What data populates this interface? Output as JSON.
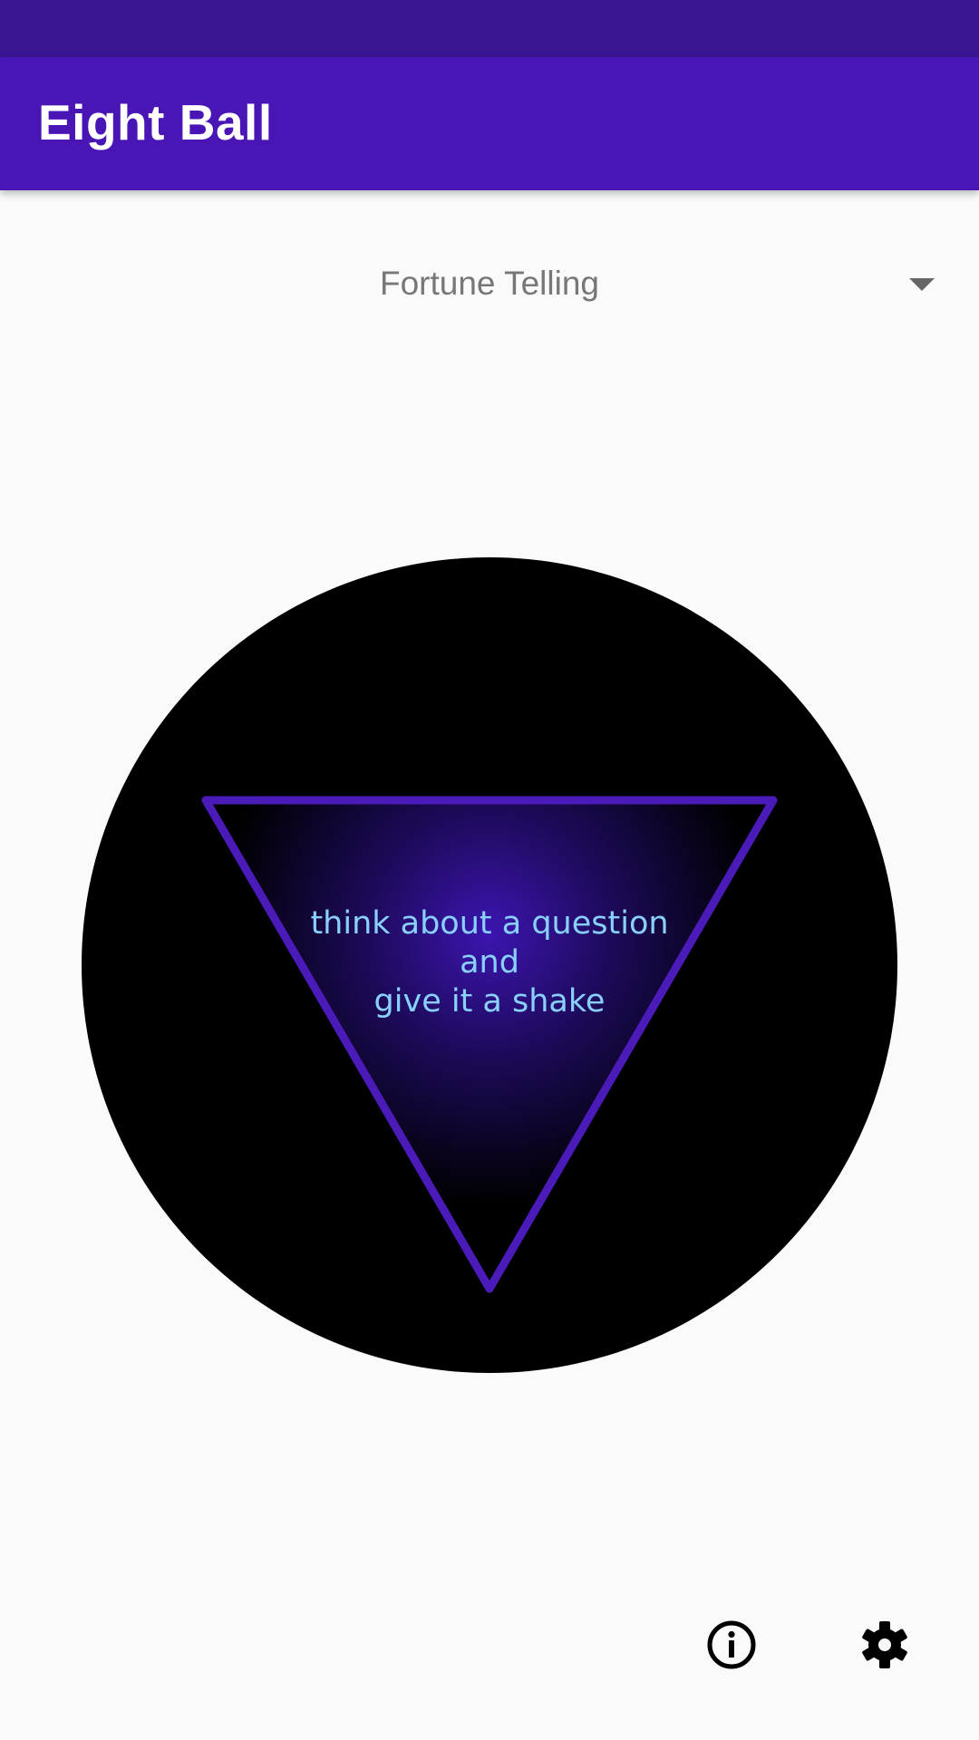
{
  "app_bar": {
    "title": "Eight Ball"
  },
  "mode_spinner": {
    "selected": "Fortune Telling"
  },
  "eight_ball": {
    "answer_lines": [
      "think about a question",
      "and",
      "give it a shake"
    ]
  },
  "bottom_actions": {
    "info_icon": "info-icon",
    "settings_icon": "settings-icon"
  },
  "colors": {
    "status_bar": "#3a1694",
    "app_bar": "#4a15b5",
    "triangle_stroke": "#4a1bb8",
    "answer_text": "#8ad0ff",
    "ball": "#000000"
  }
}
